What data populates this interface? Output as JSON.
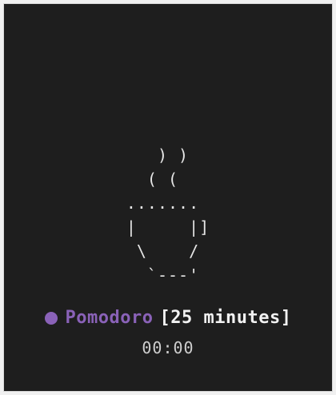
{
  "app": {
    "theme": {
      "background": "#1e1e1e",
      "text": "#e6e6e6",
      "accent": "#8a62b8"
    }
  },
  "art": {
    "coffee_cup": "   ) )\n  ( (\n.......\n|     |]\n \\    /\n  `---'"
  },
  "status": {
    "icon": "status-dot-icon",
    "mode": "Pomodoro",
    "duration": "[25 minutes]"
  },
  "timer": {
    "value": "00:00"
  }
}
